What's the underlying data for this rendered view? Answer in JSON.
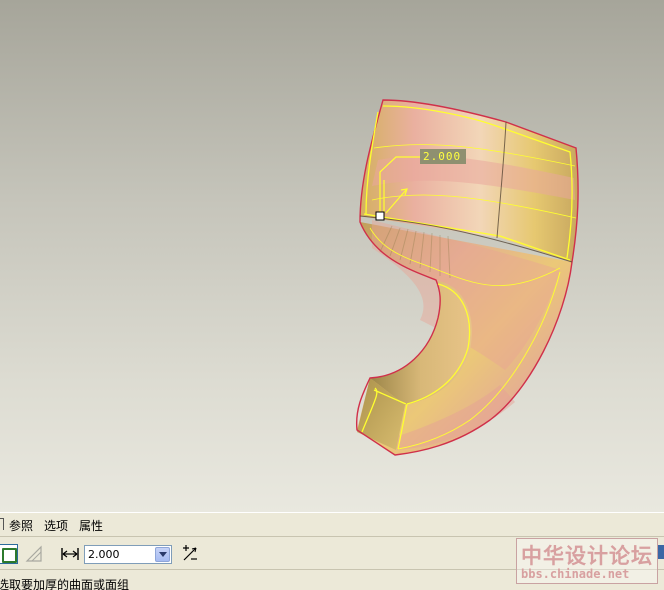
{
  "viewport": {
    "dimension_value": "2.000"
  },
  "tabs": [
    {
      "label": "参照"
    },
    {
      "label": "选项"
    },
    {
      "label": "属性"
    }
  ],
  "toolbar": {
    "thickness_value": "2.000"
  },
  "status": {
    "message": "选取要加厚的曲面或面组"
  },
  "watermark": {
    "title": "中华设计论坛",
    "url": "bbs.chinade.net"
  },
  "colors": {
    "surface_pink": "#e8a89a",
    "surface_yellow": "#e6cf72",
    "edge_red": "#d0304a",
    "highlight_yellow": "#ffff30"
  }
}
